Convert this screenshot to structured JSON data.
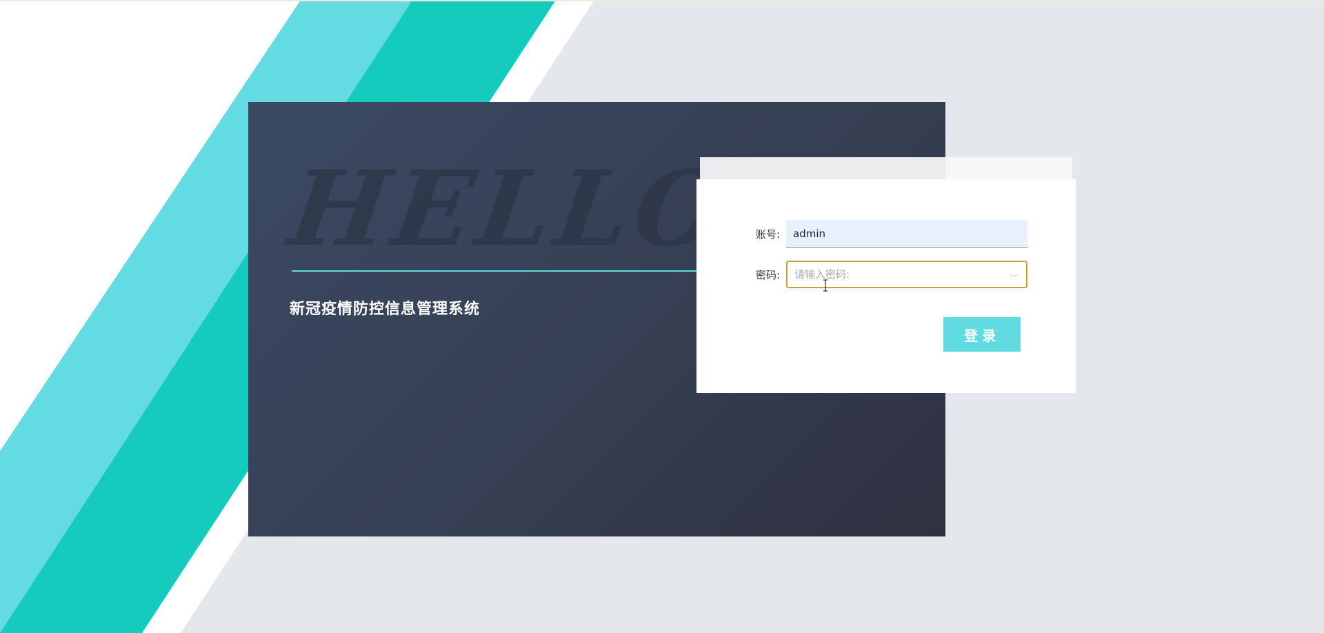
{
  "colors": {
    "page_background": "#e4e7ec",
    "stripe_light": "#62dbe2",
    "stripe_teal": "#14cbbd",
    "hero_dark": "#363f53",
    "accent_line": "#5fdbe1",
    "button": "#5fdbe1",
    "password_focus_border": "#c8a22e",
    "autofill_background": "#e8f0fe"
  },
  "hero": {
    "watermark": "HELLO",
    "title": "新冠疫情防控信息管理系统"
  },
  "login_form": {
    "username": {
      "label": "账号:",
      "value": "admin"
    },
    "password": {
      "label": "密码:",
      "value": "",
      "placeholder": "请输入密码:"
    },
    "submit_label": "登录"
  }
}
